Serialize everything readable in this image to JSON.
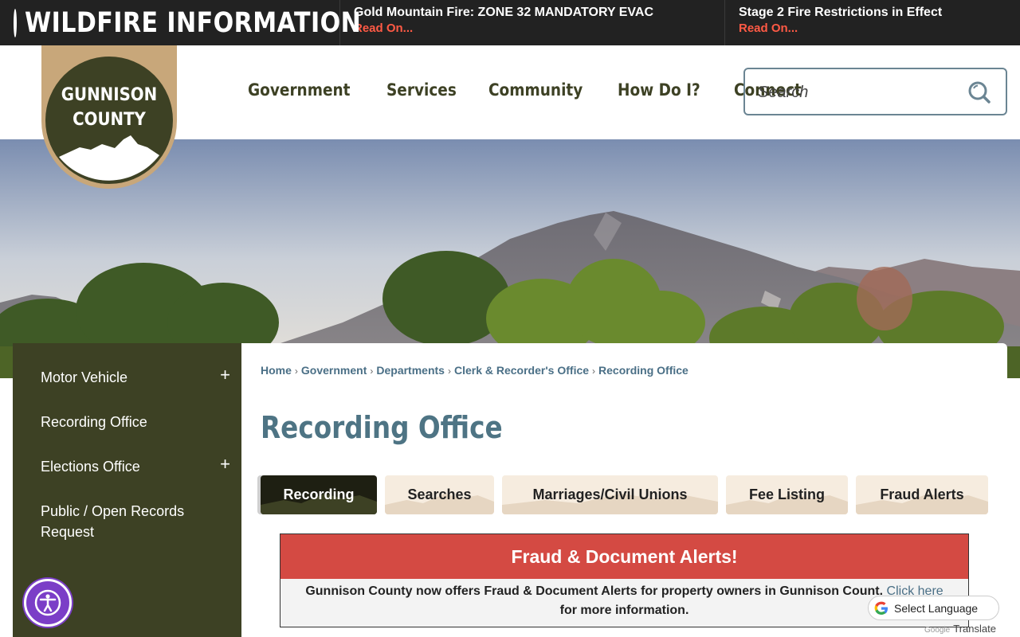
{
  "alerts": {
    "brand_title": "WILDFIRE INFORMATION",
    "items": [
      {
        "headline": "Gold Mountain Fire: ZONE 32 MANDATORY EVAC",
        "link": "Read On..."
      },
      {
        "headline": "Stage 2 Fire Restrictions in Effect",
        "link": "Read On..."
      }
    ]
  },
  "logo": {
    "line1": "GUNNISON",
    "line2": "COUNTY"
  },
  "nav": {
    "items": [
      "Government",
      "Services",
      "Community",
      "How Do I?",
      "Connect"
    ]
  },
  "search": {
    "placeholder": "Search"
  },
  "sidebar": {
    "items": [
      {
        "label": "Motor Vehicle",
        "expand": "+"
      },
      {
        "label": "Recording Office"
      },
      {
        "label": "Elections Office",
        "expand": "+"
      },
      {
        "label": "Public / Open Records Request"
      }
    ]
  },
  "breadcrumb": {
    "items": [
      "Home",
      "Government",
      "Departments",
      "Clerk & Recorder's Office",
      "Recording Office"
    ],
    "separator": "›"
  },
  "page": {
    "title": "Recording Office"
  },
  "tabs": {
    "items": [
      "Recording",
      "Searches",
      "Marriages/Civil Unions",
      "Fee Listing",
      "Fraud Alerts"
    ],
    "active": "Recording"
  },
  "fraud_alert": {
    "heading": "Fraud & Document Alerts!",
    "text_before": "Gunnison County now offers Fraud & Document Alerts for property owners in Gunnison Count.",
    "link": "Click here",
    "text_after": "for more information."
  },
  "translate": {
    "select_label": "Select Language",
    "credit_google": "Google",
    "credit_translate": "Translate"
  },
  "colors": {
    "alert_bar": "#222222",
    "alert_link": "#ff5a45",
    "olive": "#3d4124",
    "logo_tan": "#c8a77a",
    "title_teal": "#4e7484",
    "fraud_red": "#d44a43",
    "a11y_purple": "#7b3ec7"
  }
}
